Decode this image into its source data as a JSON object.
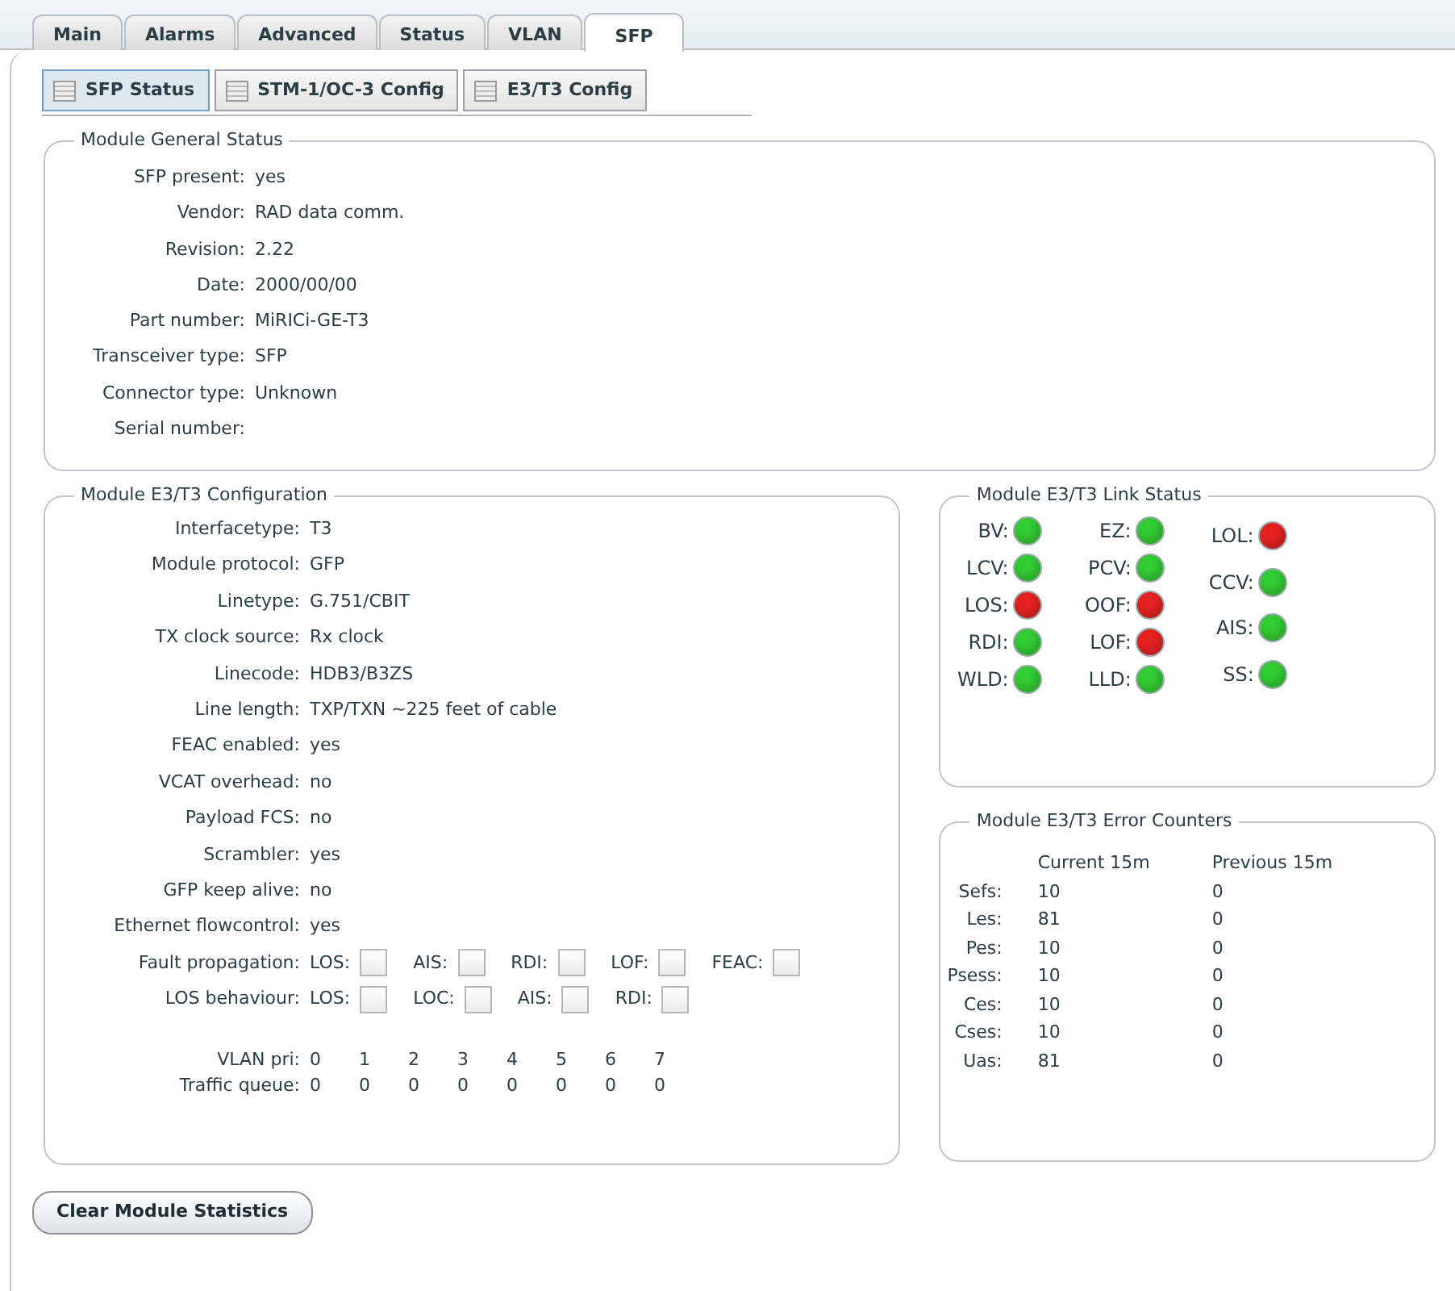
{
  "tabs": [
    {
      "label": "Main",
      "selected": false
    },
    {
      "label": "Alarms",
      "selected": false
    },
    {
      "label": "Advanced",
      "selected": false
    },
    {
      "label": "Status",
      "selected": false
    },
    {
      "label": "VLAN",
      "selected": false
    },
    {
      "label": "SFP",
      "selected": true
    }
  ],
  "subtabs": [
    {
      "label": "SFP Status",
      "selected": true
    },
    {
      "label": "STM-1/OC-3 Config",
      "selected": false
    },
    {
      "label": "E3/T3 Config",
      "selected": false
    }
  ],
  "general_status": {
    "title": "Module General Status",
    "rows": [
      {
        "label": "SFP present:",
        "value": "yes"
      },
      {
        "label": "Vendor:",
        "value": "RAD data comm."
      },
      {
        "label": "Revision:",
        "value": "2.22"
      },
      {
        "label": "Date:",
        "value": "2000/00/00"
      },
      {
        "label": "Part number:",
        "value": "MiRICi-GE-T3"
      },
      {
        "label": "Transceiver type:",
        "value": "SFP"
      },
      {
        "label": "Connector type:",
        "value": "Unknown"
      },
      {
        "label": "Serial number:"
      }
    ]
  },
  "configuration": {
    "title": "Module E3/T3 Configuration",
    "rows": [
      {
        "label": "Interfacetype:",
        "value": "T3"
      },
      {
        "label": "Module protocol:",
        "value": "GFP"
      },
      {
        "label": "Linetype:",
        "value": "G.751/CBIT"
      },
      {
        "label": "TX clock source:",
        "value": "Rx clock"
      },
      {
        "label": "Linecode:",
        "value": "HDB3/B3ZS"
      },
      {
        "label": "Line length:",
        "value": "TXP/TXN ~225 feet of cable"
      },
      {
        "label": "FEAC enabled:",
        "value": "yes"
      },
      {
        "label": "VCAT overhead:",
        "value": "no"
      },
      {
        "label": "Payload FCS:",
        "value": "no"
      },
      {
        "label": "Scrambler:",
        "value": "yes"
      },
      {
        "label": "GFP keep alive:",
        "value": "no"
      },
      {
        "label": "Ethernet flowcontrol:",
        "value": "yes"
      }
    ],
    "checkbox_rows": [
      {
        "label": "Fault propagation:",
        "items": [
          {
            "label": "LOS:",
            "checked": false
          },
          {
            "label": "AIS:",
            "checked": false
          },
          {
            "label": "RDI:",
            "checked": false
          },
          {
            "label": "LOF:",
            "checked": false
          },
          {
            "label": "FEAC:",
            "checked": false
          }
        ]
      },
      {
        "label": "LOS behaviour:",
        "items": [
          {
            "label": "LOS:",
            "checked": false
          },
          {
            "label": "LOC:",
            "checked": false
          },
          {
            "label": "AIS:",
            "checked": false
          },
          {
            "label": "RDI:",
            "checked": false
          }
        ]
      }
    ],
    "vlan_map": [
      {
        "label": "VLAN pri:",
        "values": [
          "0",
          "1",
          "2",
          "3",
          "4",
          "5",
          "6",
          "7"
        ]
      },
      {
        "label": "Traffic queue:",
        "values": [
          "0",
          "0",
          "0",
          "0",
          "0",
          "0",
          "0",
          "0"
        ]
      }
    ]
  },
  "link_status": {
    "title": "Module E3/T3 Link Status",
    "columns": [
      [
        {
          "label": "BV:",
          "color": "#33cc33"
        },
        {
          "label": "LCV:",
          "color": "#33cc33"
        },
        {
          "label": "LOS:",
          "color": "#e52222"
        },
        {
          "label": "RDI:",
          "color": "#33cc33"
        },
        {
          "label": "WLD:",
          "color": "#33cc33"
        }
      ],
      [
        {
          "label": "EZ:",
          "color": "#33cc33"
        },
        {
          "label": "PCV:",
          "color": "#33cc33"
        },
        {
          "label": "OOF:",
          "color": "#e52222"
        },
        {
          "label": "LOF:",
          "color": "#e52222"
        },
        {
          "label": "LLD:",
          "color": "#33cc33"
        }
      ],
      [
        {
          "label": "LOL:",
          "color": "#e52222"
        },
        {
          "label": "CCV:",
          "color": "#33cc33"
        },
        {
          "label": "AIS:",
          "color": "#33cc33"
        },
        {
          "label": "SS:",
          "color": "#33cc33"
        }
      ]
    ]
  },
  "error_counters": {
    "title": "Module E3/T3 Error Counters",
    "columns": [
      "Current 15m",
      "Previous 15m"
    ],
    "rows": [
      {
        "label": "Sefs:",
        "current": "10",
        "previous": "0"
      },
      {
        "label": "Les:",
        "current": "81",
        "previous": "0"
      },
      {
        "label": "Pes:",
        "current": "10",
        "previous": "0"
      },
      {
        "label": "Psess:",
        "current": "10",
        "previous": "0"
      },
      {
        "label": "Ces:",
        "current": "10",
        "previous": "0"
      },
      {
        "label": "Cses:",
        "current": "10",
        "previous": "0"
      },
      {
        "label": "Uas:",
        "current": "81",
        "previous": "0"
      }
    ]
  },
  "button": "Clear Module Statistics"
}
